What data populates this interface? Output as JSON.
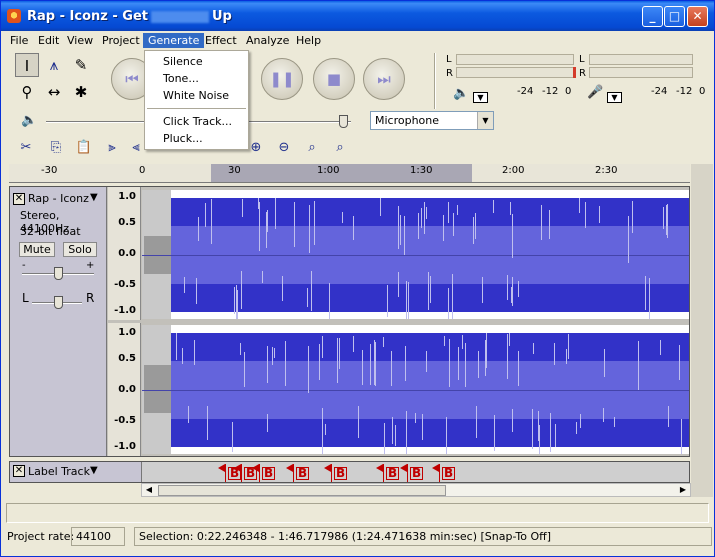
{
  "window": {
    "title_prefix": "Rap - Iconz - Get",
    "title_suffix": "Up",
    "minimize": "_",
    "maximize": "□",
    "close": "✕"
  },
  "menubar": [
    "File",
    "Edit",
    "View",
    "Project",
    "Generate",
    "Effect",
    "Analyze",
    "Help"
  ],
  "generate_menu": {
    "items": [
      "Silence",
      "Tone...",
      "White Noise",
      "Click Track...",
      "Pluck..."
    ]
  },
  "meters": {
    "playback": {
      "left": "L",
      "right": "R",
      "scale": [
        "-24",
        "-12",
        "0"
      ],
      "icon": "speaker-icon"
    },
    "record": {
      "left": "L",
      "right": "R",
      "scale": [
        "-24",
        "-12",
        "0"
      ],
      "icon": "microphone-icon"
    }
  },
  "mixer": {
    "input_source": "Microphone",
    "output_volume": 0.9
  },
  "ruler": {
    "labels": [
      "-30",
      "0",
      "30",
      "1:00",
      "1:30",
      "2:00",
      "2:30"
    ]
  },
  "audio_track": {
    "name": "Rap - Iconz",
    "format": "Stereo, 44100Hz",
    "bit_depth": "32-bit float",
    "mute_label": "Mute",
    "solo_label": "Solo",
    "gain_min": "-",
    "gain_max": "+",
    "pan_left": "L",
    "pan_right": "R",
    "scale_labels": [
      "1.0",
      "0.5",
      "0.0",
      "-0.5",
      "-1.0"
    ]
  },
  "label_track": {
    "name": "Label Track",
    "labels": [
      "B",
      "B",
      "B",
      "B",
      "B",
      "B",
      "B",
      "B",
      "B"
    ]
  },
  "status": {
    "project_rate_label": "Project rate:",
    "project_rate": "44100",
    "selection": "Selection: 0:22.246348 - 1:46.717986 (1:24.471638 min:sec)   [Snap-To Off]"
  },
  "colors": {
    "titlebar": "#0549d2",
    "waveform_outer": "#3232c8",
    "waveform_inner": "#6464dc",
    "menu_highlight": "#316ac5",
    "label_red": "#c00000"
  }
}
